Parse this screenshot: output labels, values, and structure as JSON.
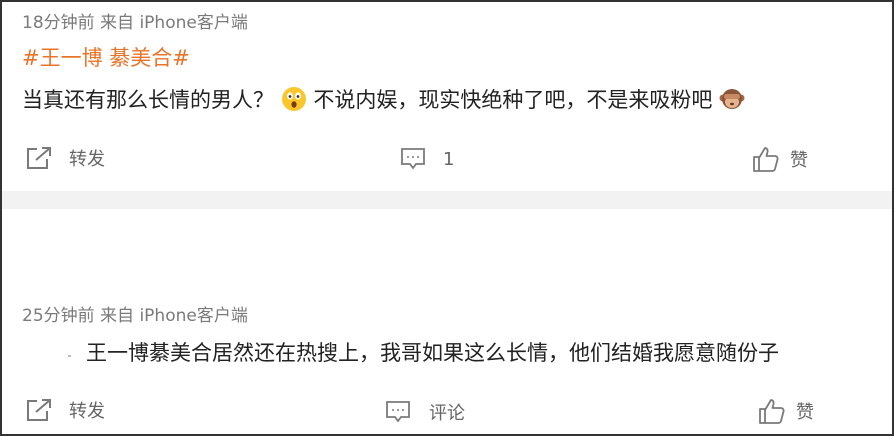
{
  "posts": [
    {
      "meta": "18分钟前  来自 iPhone客户端",
      "hashtag": "#王一博 綦美合#",
      "text_before": "当真还有那么长情的男人？",
      "text_after": "不说内娱，现实快绝种了吧，不是来吸粉吧",
      "emojis": [
        "astonished-emoji",
        "monkey-emoji"
      ],
      "actions": {
        "repost": "转发",
        "comment": "1",
        "like": "赞"
      }
    },
    {
      "meta": "25分钟前  来自 iPhone客户端",
      "text": "王一博綦美合居然还在热搜上，我哥如果这么长情，他们结婚我愿意随份子",
      "actions": {
        "repost": "转发",
        "comment": "评论",
        "like": "赞"
      }
    }
  ]
}
